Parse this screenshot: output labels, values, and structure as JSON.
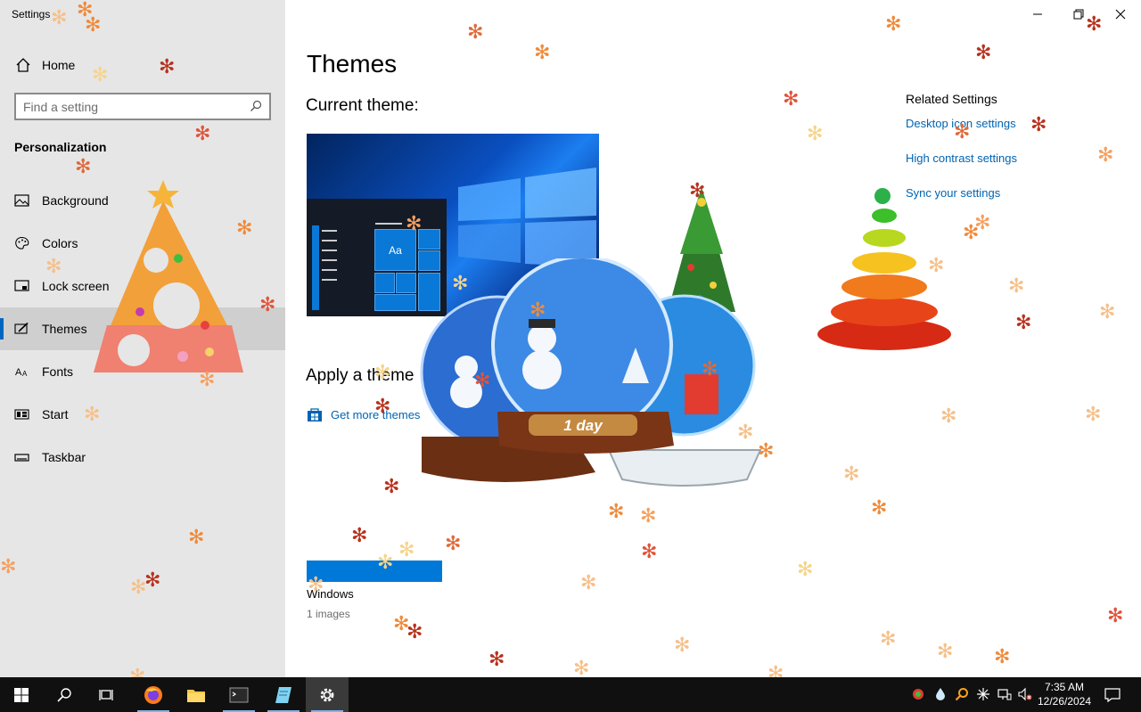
{
  "window": {
    "title": "Settings"
  },
  "sidebar": {
    "home_label": "Home",
    "search_placeholder": "Find a setting",
    "section": "Personalization",
    "items": [
      {
        "label": "Background",
        "icon": "picture-icon"
      },
      {
        "label": "Colors",
        "icon": "palette-icon"
      },
      {
        "label": "Lock screen",
        "icon": "lock-screen-icon"
      },
      {
        "label": "Themes",
        "icon": "brush-icon",
        "active": true
      },
      {
        "label": "Fonts",
        "icon": "font-icon"
      },
      {
        "label": "Start",
        "icon": "start-icon"
      },
      {
        "label": "Taskbar",
        "icon": "taskbar-icon"
      }
    ]
  },
  "main": {
    "title": "Themes",
    "current_theme_label": "Current theme:",
    "preview_tile_text": "Aa",
    "apply_title": "Apply a theme",
    "get_more_label": "Get more themes",
    "themes": [
      {
        "name": "Windows",
        "count": "1 images"
      }
    ],
    "related": {
      "heading": "Related Settings",
      "links": [
        "Desktop icon settings",
        "High contrast settings",
        "Sync your settings"
      ]
    }
  },
  "decorations": {
    "globe_label": "1 day"
  },
  "taskbar": {
    "apps": [
      "start-icon",
      "search-icon",
      "task-view-icon",
      "firefox-icon",
      "file-explorer-icon",
      "terminal-icon",
      "notepad-icon",
      "settings-icon"
    ],
    "clock_time": "7:35 AM",
    "clock_date": "12/26/2024"
  },
  "colors": {
    "accent": "#0078d7",
    "link": "#0063b1",
    "sidebar_bg": "#e6e6e6",
    "taskbar_bg": "#101010"
  }
}
